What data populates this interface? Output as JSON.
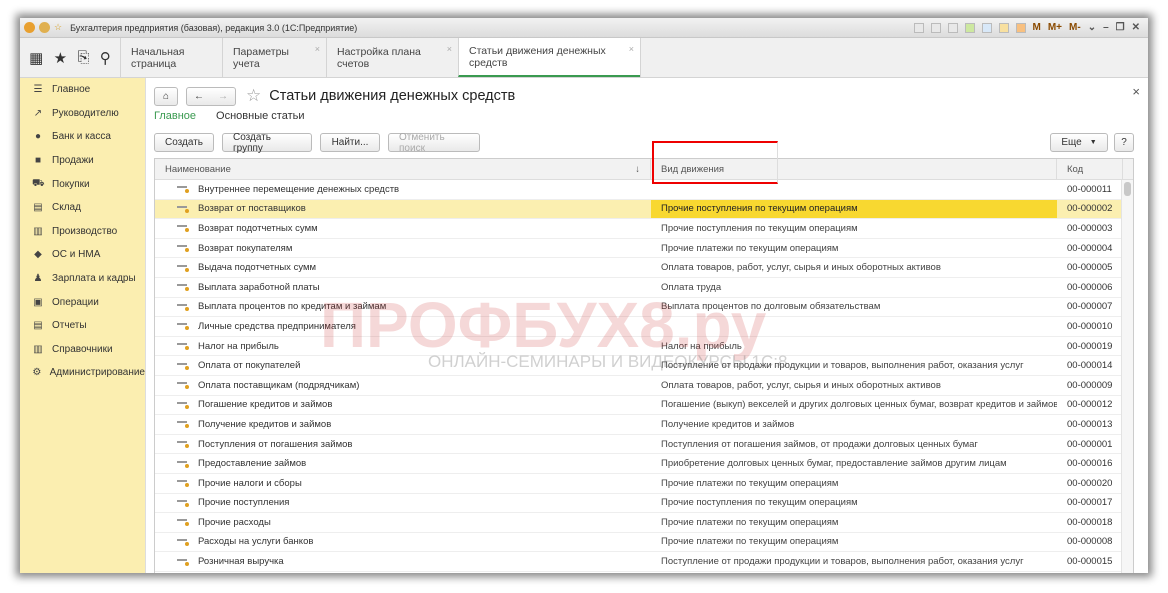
{
  "window": {
    "title": "Бухгалтерия предприятия (базовая), редакция 3.0  (1С:Предприятие)",
    "memory_buttons": [
      "M",
      "M+",
      "M-"
    ]
  },
  "tabs": [
    {
      "label": "Начальная страница"
    },
    {
      "label": "Параметры учета"
    },
    {
      "label": "Настройка плана счетов"
    },
    {
      "label": "Статьи движения денежных средств",
      "active": true
    }
  ],
  "sidebar": {
    "items": [
      {
        "label": "Главное",
        "icon": "menu-icon"
      },
      {
        "label": "Руководителю",
        "icon": "chart-icon"
      },
      {
        "label": "Банк и касса",
        "icon": "coin-icon"
      },
      {
        "label": "Продажи",
        "icon": "bag-icon"
      },
      {
        "label": "Покупки",
        "icon": "cart-icon"
      },
      {
        "label": "Склад",
        "icon": "warehouse-icon"
      },
      {
        "label": "Производство",
        "icon": "factory-icon"
      },
      {
        "label": "ОС и НМА",
        "icon": "assets-icon"
      },
      {
        "label": "Зарплата и кадры",
        "icon": "people-icon"
      },
      {
        "label": "Операции",
        "icon": "operations-icon"
      },
      {
        "label": "Отчеты",
        "icon": "reports-icon"
      },
      {
        "label": "Справочники",
        "icon": "books-icon"
      },
      {
        "label": "Администрирование",
        "icon": "gear-icon"
      }
    ]
  },
  "page": {
    "title": "Статьи движения денежных средств",
    "sections": [
      "Главное",
      "Основные статьи"
    ]
  },
  "toolbar": {
    "create": "Создать",
    "create_group": "Создать группу",
    "find": "Найти...",
    "cancel_search": "Отменить поиск",
    "more": "Еще",
    "help": "?"
  },
  "table": {
    "columns": [
      "Наименование",
      "Вид движения",
      "Код"
    ],
    "sort_indicator": "↓",
    "selected_row": 1,
    "rows": [
      [
        "Внутреннее перемещение денежных средств",
        "",
        "00-000011"
      ],
      [
        "Возврат от поставщиков",
        "Прочие поступления по текущим операциям",
        "00-000002"
      ],
      [
        "Возврат подотчетных сумм",
        "Прочие поступления по текущим операциям",
        "00-000003"
      ],
      [
        "Возврат покупателям",
        "Прочие платежи по текущим операциям",
        "00-000004"
      ],
      [
        "Выдача подотчетных сумм",
        "Оплата товаров, работ, услуг, сырья и иных оборотных активов",
        "00-000005"
      ],
      [
        "Выплата заработной платы",
        "Оплата труда",
        "00-000006"
      ],
      [
        "Выплата процентов по кредитам и займам",
        "Выплата процентов по долговым обязательствам",
        "00-000007"
      ],
      [
        "Личные средства предпринимателя",
        "",
        "00-000010"
      ],
      [
        "Налог на прибыль",
        "Налог на прибыль",
        "00-000019"
      ],
      [
        "Оплата от покупателей",
        "Поступление от продажи продукции и товаров, выполнения работ, оказания услуг",
        "00-000014"
      ],
      [
        "Оплата поставщикам (подрядчикам)",
        "Оплата товаров, работ, услуг, сырья и иных оборотных активов",
        "00-000009"
      ],
      [
        "Погашение кредитов и займов",
        "Погашение (выкуп) векселей и других долговых ценных бумаг, возврат кредитов и займов",
        "00-000012"
      ],
      [
        "Получение кредитов и займов",
        "Получение кредитов и займов",
        "00-000013"
      ],
      [
        "Поступления от погашения займов",
        "Поступления от погашения займов, от продажи долговых ценных бумаг",
        "00-000001"
      ],
      [
        "Предоставление займов",
        "Приобретение долговых ценных бумаг, предоставление займов другим лицам",
        "00-000016"
      ],
      [
        "Прочие налоги и сборы",
        "Прочие платежи по текущим операциям",
        "00-000020"
      ],
      [
        "Прочие поступления",
        "Прочие поступления по текущим операциям",
        "00-000017"
      ],
      [
        "Прочие расходы",
        "Прочие платежи по текущим операциям",
        "00-000018"
      ],
      [
        "Расходы на услуги банков",
        "Прочие платежи по текущим операциям",
        "00-000008"
      ],
      [
        "Розничная выручка",
        "Поступление от продажи продукции и товаров, выполнения работ, оказания услуг",
        "00-000015"
      ]
    ]
  },
  "watermark": {
    "main": "ПРОФБУХ8.ру",
    "sub": "ОНЛАЙН-СЕМИНАРЫ И ВИДЕОКУРСЫ 1С:8"
  },
  "colors": {
    "accent": "#3a9a50",
    "sidebar": "#fbeeb0",
    "selection": "#f8d830",
    "highlight_box": "#e00000"
  }
}
